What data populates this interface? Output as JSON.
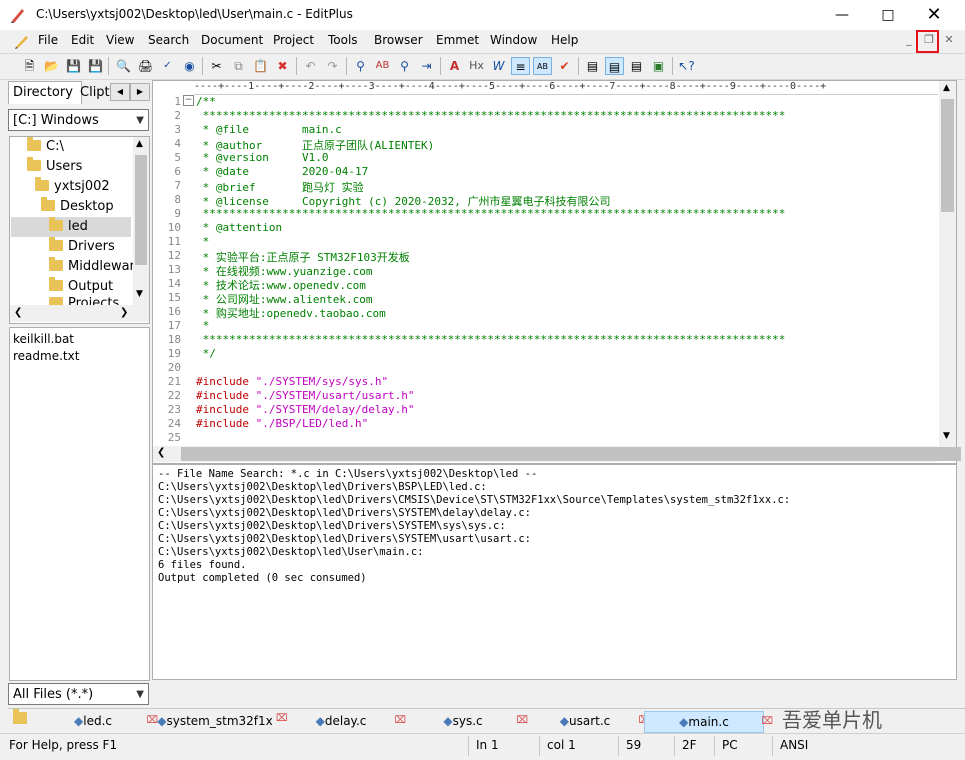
{
  "window": {
    "title": "C:\\Users\\yxtsj002\\Desktop\\led\\User\\main.c - EditPlus"
  },
  "menu": [
    "File",
    "Edit",
    "View",
    "Search",
    "Document",
    "Project",
    "Tools",
    "Browser",
    "Emmet",
    "Window",
    "Help"
  ],
  "left_pane": {
    "tabs": [
      "Directory",
      "Clipt"
    ],
    "drive": "[C:] Windows",
    "tree": [
      "C:\\",
      "Users",
      "yxtsj002",
      "Desktop",
      "led",
      "Drivers",
      "Middlewar",
      "Output",
      "Projects"
    ],
    "selected": "led",
    "files": [
      "keilkill.bat",
      "readme.txt"
    ],
    "filter": "All Files (*.*)"
  },
  "ruler": "----+----1----+----2----+----3----+----4----+----5----+----6----+----7----+----8----+----9----+----0----+",
  "code_lines": [
    {
      "n": "1",
      "t": "/**",
      "c": "cmt"
    },
    {
      "n": "2",
      "t": " ****************************************************************************************",
      "c": "cmt"
    },
    {
      "n": "3",
      "t": " * @file        main.c",
      "c": "cmt"
    },
    {
      "n": "4",
      "t": " * @author      正点原子团队(ALIENTEK)",
      "c": "cmt"
    },
    {
      "n": "5",
      "t": " * @version     V1.0",
      "c": "cmt"
    },
    {
      "n": "6",
      "t": " * @date        2020-04-17",
      "c": "cmt"
    },
    {
      "n": "7",
      "t": " * @brief       跑马灯 实验",
      "c": "cmt"
    },
    {
      "n": "8",
      "t": " * @license     Copyright (c) 2020-2032, 广州市星翼电子科技有限公司",
      "c": "cmt"
    },
    {
      "n": "9",
      "t": " ****************************************************************************************",
      "c": "cmt"
    },
    {
      "n": "10",
      "t": " * @attention",
      "c": "cmt"
    },
    {
      "n": "11",
      "t": " *",
      "c": "cmt"
    },
    {
      "n": "12",
      "t": " * 实验平台:正点原子 STM32F103开发板",
      "c": "cmt"
    },
    {
      "n": "13",
      "t": " * 在线视频:www.yuanzige.com",
      "c": "cmt"
    },
    {
      "n": "14",
      "t": " * 技术论坛:www.openedv.com",
      "c": "cmt"
    },
    {
      "n": "15",
      "t": " * 公司网址:www.alientek.com",
      "c": "cmt"
    },
    {
      "n": "16",
      "t": " * 购买地址:openedv.taobao.com",
      "c": "cmt"
    },
    {
      "n": "17",
      "t": " *",
      "c": "cmt"
    },
    {
      "n": "18",
      "t": " ****************************************************************************************",
      "c": "cmt"
    },
    {
      "n": "19",
      "t": " */",
      "c": "cmt"
    },
    {
      "n": "20",
      "t": "",
      "c": ""
    },
    {
      "n": "21",
      "pp": "#include",
      "s": "\"./SYSTEM/sys/sys.h\""
    },
    {
      "n": "22",
      "pp": "#include",
      "s": "\"./SYSTEM/usart/usart.h\""
    },
    {
      "n": "23",
      "pp": "#include",
      "s": "\"./SYSTEM/delay/delay.h\""
    },
    {
      "n": "24",
      "pp": "#include",
      "s": "\"./BSP/LED/led.h\""
    },
    {
      "n": "25",
      "t": "",
      "c": ""
    }
  ],
  "output_lines": [
    "-- File Name Search: *.c in C:\\Users\\yxtsj002\\Desktop\\led --",
    "C:\\Users\\yxtsj002\\Desktop\\led\\Drivers\\BSP\\LED\\led.c:",
    "C:\\Users\\yxtsj002\\Desktop\\led\\Drivers\\CMSIS\\Device\\ST\\STM32F1xx\\Source\\Templates\\system_stm32f1xx.c:",
    "C:\\Users\\yxtsj002\\Desktop\\led\\Drivers\\SYSTEM\\delay\\delay.c:",
    "C:\\Users\\yxtsj002\\Desktop\\led\\Drivers\\SYSTEM\\sys\\sys.c:",
    "C:\\Users\\yxtsj002\\Desktop\\led\\Drivers\\SYSTEM\\usart\\usart.c:",
    "C:\\Users\\yxtsj002\\Desktop\\led\\User\\main.c:",
    "6 files found.",
    "Output completed (0 sec consumed)"
  ],
  "file_tabs": [
    "led.c",
    "system_stm32f1x",
    "delay.c",
    "sys.c",
    "usart.c",
    "main.c"
  ],
  "active_tab": "main.c",
  "status": {
    "help": "For Help, press F1",
    "line": "In 1",
    "col": "col 1",
    "num": "59",
    "x": "2F",
    "mode": "PC",
    "enc": "ANSI"
  },
  "watermark": "吾爱单片机",
  "colors": {
    "comment": "#008000",
    "preprocessor": "#c00000",
    "string": "#c000c0",
    "highlight": "#e8111b"
  }
}
